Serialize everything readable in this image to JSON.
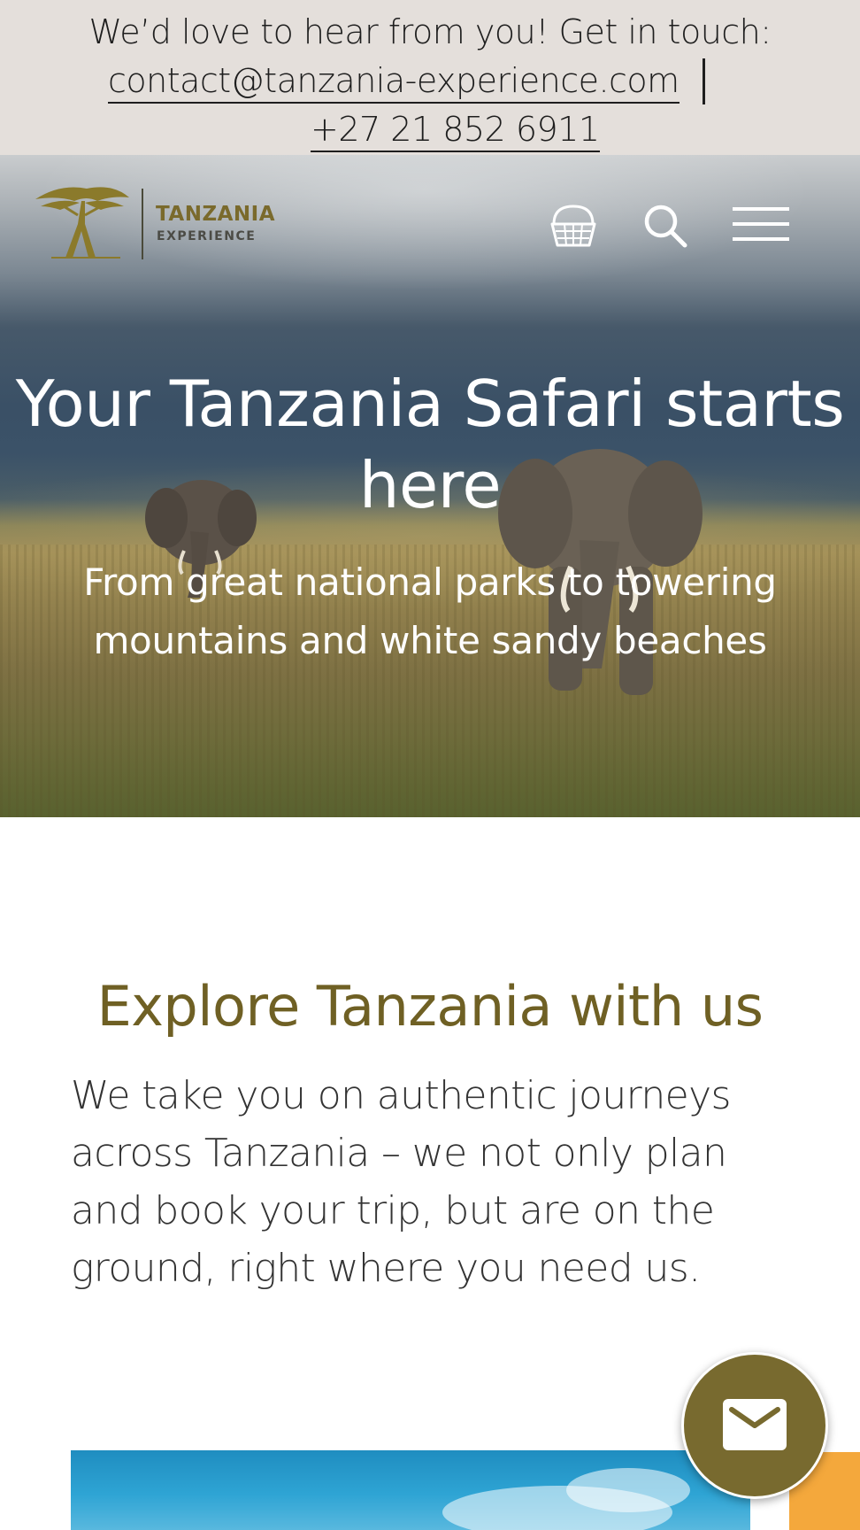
{
  "contact_bar": {
    "intro": "We’d love to hear from you! Get in touch:",
    "email": "contact@tanzania-experience.com",
    "separator": "|",
    "phone": "+27 21 852 6911"
  },
  "header": {
    "logo": {
      "title": "TANZANIA",
      "subtitle": "EXPERIENCE"
    },
    "icons": [
      "basket-icon",
      "search-icon",
      "menu-icon"
    ]
  },
  "hero": {
    "title": "Your Tanzania Safari starts here",
    "subtitle": "From great national parks to towering mountains and white sandy beaches"
  },
  "intro": {
    "title": "Explore Tanzania with us",
    "text": "We take you on authentic journeys across Tanzania – we not only plan and book your trip, but are on the ground, right where you need us."
  },
  "floating_button": {
    "icon": "mail-icon"
  },
  "colors": {
    "contact_bar_bg": "#e4dfdb",
    "brand_olive": "#786a2f",
    "heading_olive": "#6f6024",
    "body_text": "#333333"
  }
}
